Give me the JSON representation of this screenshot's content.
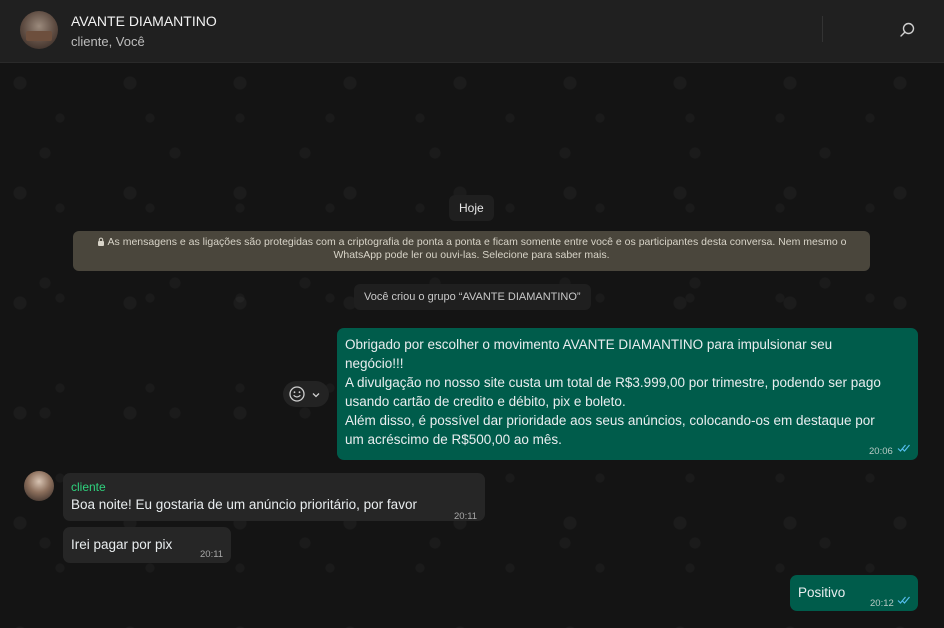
{
  "header": {
    "title": "AVANTE DIAMANTINO",
    "subtitle": "cliente, Você",
    "search_icon": "search-icon"
  },
  "chat": {
    "date_label": "Hoje",
    "encryption_notice_line1": "As mensagens e as ligações são protegidas com a criptografia de ponta a ponta e ficam somente entre você e os participantes desta conversa. Nem mesmo o",
    "encryption_notice_line2": "WhatsApp pode ler ou ouvi-las. Selecione para saber mais.",
    "system_message": "Você criou o grupo “AVANTE DIAMANTINO”",
    "messages": [
      {
        "direction": "out",
        "lines": [
          "Obrigado por escolher o movimento AVANTE DIAMANTINO para impulsionar seu",
          "negócio!!!",
          "A divulgação no nosso site custa um total de R$3.999,00 por trimestre, podendo ser pago",
          "usando cartão de credito e débito, pix e boleto.",
          "Além disso, é possível dar prioridade aos seus anúncios, colocando-os em destaque  por",
          "um acréscimo de R$500,00 ao mês."
        ],
        "time": "20:06",
        "status": "read"
      },
      {
        "direction": "in",
        "sender": "cliente",
        "text": "Boa noite! Eu gostaria de um anúncio prioritário, por favor",
        "time": "20:11"
      },
      {
        "direction": "in",
        "text": "Irei pagar por pix",
        "time": "20:11"
      },
      {
        "direction": "out",
        "text": "Positivo",
        "time": "20:12",
        "status": "read"
      }
    ]
  },
  "colors": {
    "outgoing_bubble": "#005c4b",
    "incoming_bubble": "#262626",
    "sender_name": "#2fd37e",
    "read_ticks": "#53bdeb"
  }
}
